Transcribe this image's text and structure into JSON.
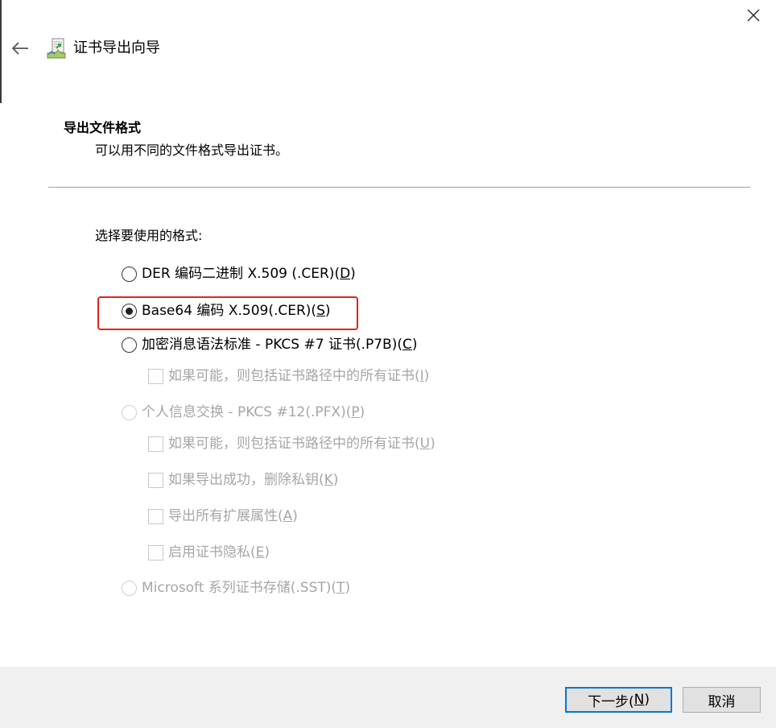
{
  "window": {
    "title": "证书导出向导",
    "icons": {
      "back": "back-arrow-icon",
      "close": "close-icon",
      "app": "certificate-wizard-icon"
    }
  },
  "section": {
    "title": "导出文件格式",
    "description": "可以用不同的文件格式导出证书。"
  },
  "prompt": "选择要使用的格式:",
  "options": {
    "der": {
      "label": "DER 编码二进制 X.509 (.CER)(",
      "mnemonic": "D",
      "suffix": ")",
      "selected": false,
      "enabled": true
    },
    "base64": {
      "label": "Base64 编码 X.509(.CER)(",
      "mnemonic": "S",
      "suffix": ")",
      "selected": true,
      "enabled": true
    },
    "pkcs7": {
      "label": "加密消息语法标准 - PKCS #7 证书(.P7B)(",
      "mnemonic": "C",
      "suffix": ")",
      "selected": false,
      "enabled": true
    },
    "pkcs7_include_chain": {
      "label": "如果可能，则包括证书路径中的所有证书(",
      "mnemonic": "I",
      "suffix": ")",
      "checked": false,
      "enabled": false
    },
    "pfx": {
      "label": "个人信息交换 - PKCS #12(.PFX)(",
      "mnemonic": "P",
      "suffix": ")",
      "selected": false,
      "enabled": false
    },
    "pfx_include_chain": {
      "label": "如果可能，则包括证书路径中的所有证书(",
      "mnemonic": "U",
      "suffix": ")",
      "checked": false,
      "enabled": false
    },
    "pfx_delete_key": {
      "label": "如果导出成功，删除私钥(",
      "mnemonic": "K",
      "suffix": ")",
      "checked": false,
      "enabled": false
    },
    "pfx_export_props": {
      "label": "导出所有扩展属性(",
      "mnemonic": "A",
      "suffix": ")",
      "checked": false,
      "enabled": false
    },
    "pfx_privacy": {
      "label": "启用证书隐私(",
      "mnemonic": "E",
      "suffix": ")",
      "checked": false,
      "enabled": false
    },
    "sst": {
      "label": "Microsoft 系列证书存储(.SST)(",
      "mnemonic": "T",
      "suffix": ")",
      "selected": false,
      "enabled": false
    }
  },
  "buttons": {
    "next": {
      "label": "下一步(",
      "mnemonic": "N",
      "suffix": ")"
    },
    "cancel": {
      "label": "取消"
    }
  },
  "colors": {
    "highlight": "#e2231a",
    "primary_button_border": "#0078d7",
    "footer_bg": "#f0f0f0",
    "disabled_text": "#a6a6a6"
  }
}
